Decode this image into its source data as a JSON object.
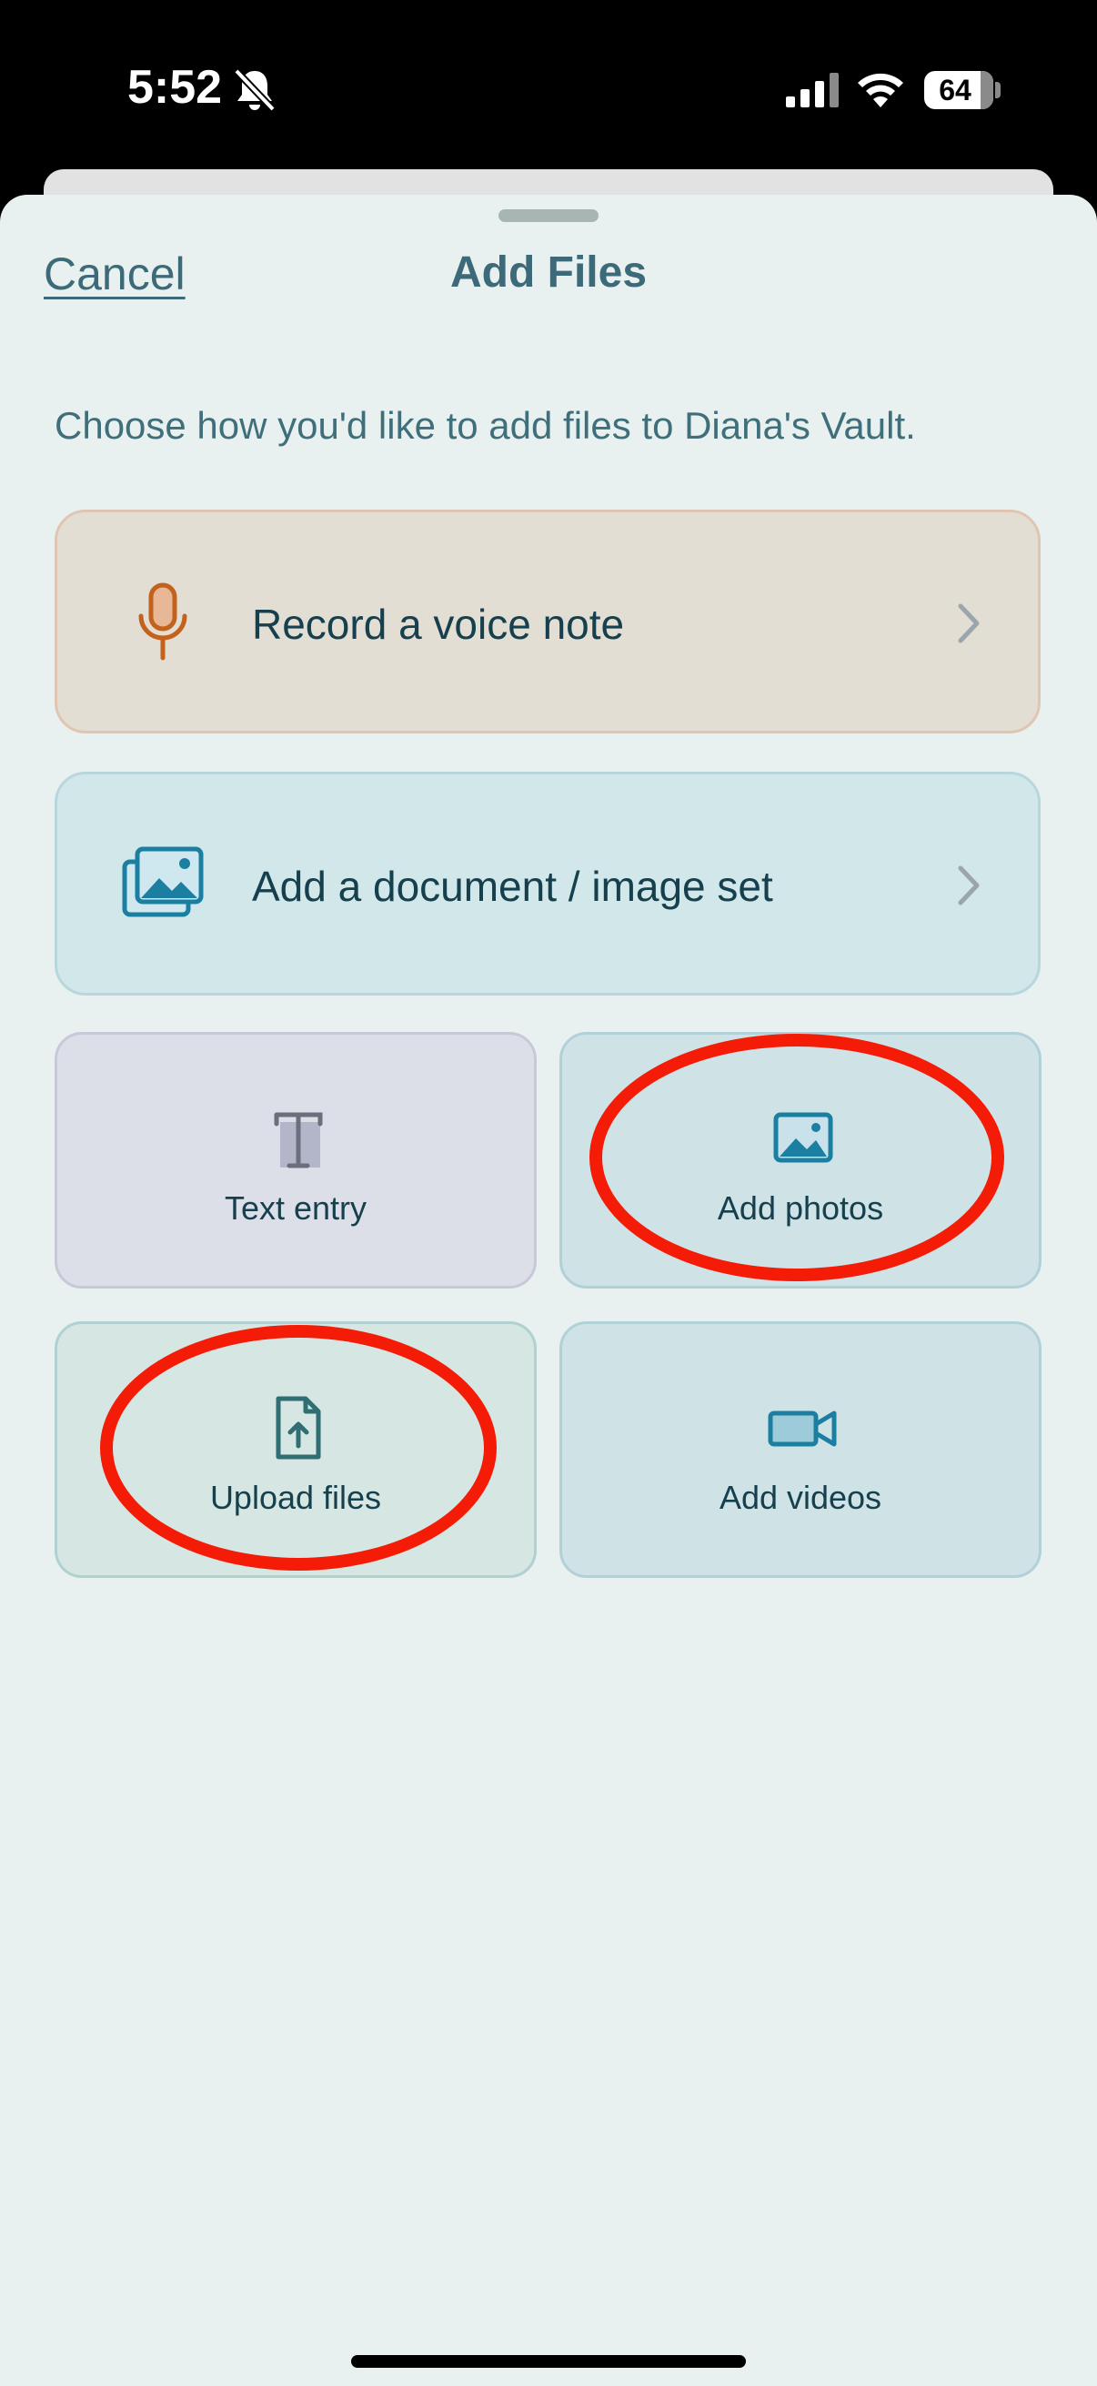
{
  "status_bar": {
    "time": "5:52",
    "battery": "64"
  },
  "header": {
    "cancel_label": "Cancel",
    "title": "Add Files"
  },
  "subtitle": "Choose how you'd like to add files to Diana's Vault.",
  "wide_options": [
    {
      "label": "Record a voice note",
      "icon": "microphone-icon",
      "accent": "#c2621c"
    },
    {
      "label": "Add a document / image set",
      "icon": "image-stack-icon",
      "accent": "#1a7fa0"
    }
  ],
  "tiles": [
    {
      "label": "Text entry",
      "icon": "text-t-icon"
    },
    {
      "label": "Add photos",
      "icon": "image-icon"
    },
    {
      "label": "Upload files",
      "icon": "file-upload-icon"
    },
    {
      "label": "Add videos",
      "icon": "video-camera-icon"
    }
  ],
  "colors": {
    "sheet_background": "#e9f1f0",
    "title_text": "#3d6a78",
    "annotation_red": "#f41c07"
  }
}
